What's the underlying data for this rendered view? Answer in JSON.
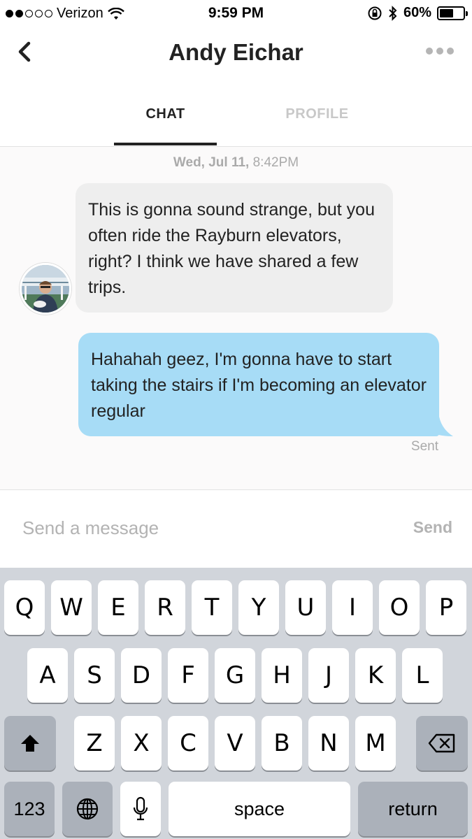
{
  "status_bar": {
    "carrier": "Verizon",
    "time": "9:59 PM",
    "battery_percent": "60%",
    "battery_level": 0.6,
    "icons": [
      "signal-dots-icon",
      "wifi-icon",
      "rotation-lock-icon",
      "bluetooth-icon",
      "battery-icon"
    ]
  },
  "header": {
    "title": "Andy Eichar",
    "back_icon": "chevron-left-icon",
    "more_icon": "more-dots-icon"
  },
  "tabs": {
    "chat": "CHAT",
    "profile": "PROFILE",
    "active": "chat"
  },
  "conversation": {
    "date": "Wed, Jul 11,",
    "time": "8:42PM",
    "messages": [
      {
        "direction": "incoming",
        "text": "This is gonna sound strange, but you often ride the Rayburn elevators, right? I think we have shared a few trips."
      },
      {
        "direction": "outgoing",
        "text": "Hahahah geez, I'm gonna have to start taking the stairs if I'm becoming an elevator regular"
      }
    ],
    "status": "Sent"
  },
  "composer": {
    "placeholder": "Send a message",
    "value": "",
    "send_label": "Send"
  },
  "keyboard": {
    "row1": [
      "Q",
      "W",
      "E",
      "R",
      "T",
      "Y",
      "U",
      "I",
      "O",
      "P"
    ],
    "row2": [
      "A",
      "S",
      "D",
      "F",
      "G",
      "H",
      "J",
      "K",
      "L"
    ],
    "row3": [
      "Z",
      "X",
      "C",
      "V",
      "B",
      "N",
      "M"
    ],
    "numbers_label": "123",
    "space_label": "space",
    "return_label": "return",
    "shift_icon": "shift-arrow-icon",
    "delete_icon": "backspace-icon",
    "globe_icon": "globe-icon",
    "mic_icon": "microphone-icon"
  },
  "colors": {
    "outgoing_bubble": "#a7dcf6",
    "incoming_bubble": "#eeeeee",
    "keyboard_bg": "#d1d5db"
  }
}
